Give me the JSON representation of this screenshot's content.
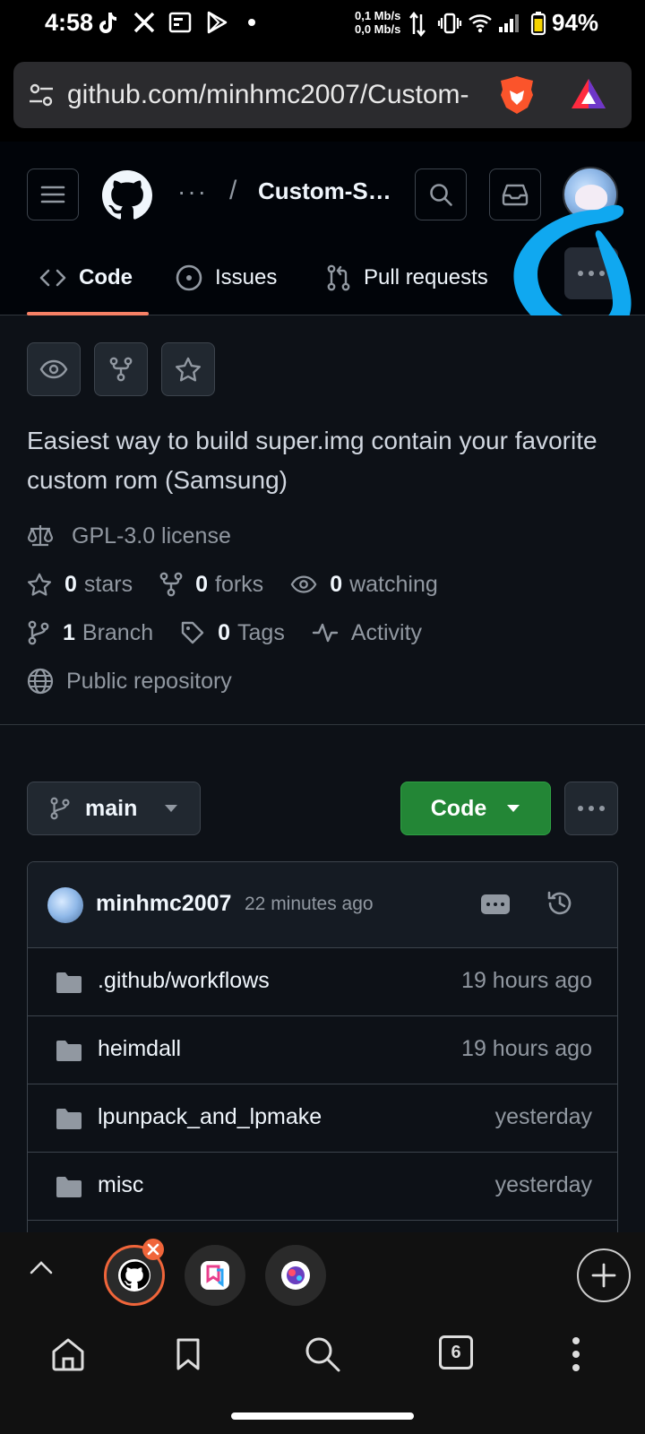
{
  "status_bar": {
    "time": "4:58",
    "net_up": "0,1 Mb/s",
    "net_down": "0,0 Mb/s",
    "battery": "94%"
  },
  "browser": {
    "url": "github.com/minhmc2007/Custom-"
  },
  "header": {
    "breadcrumb_dots": "···",
    "breadcrumb_sep": "/",
    "repo_name": "Custom-S…"
  },
  "tabs": [
    {
      "label": "Code",
      "icon": "code-icon"
    },
    {
      "label": "Issues",
      "icon": "issue-icon"
    },
    {
      "label": "Pull requests",
      "icon": "pull-request-icon"
    }
  ],
  "repo": {
    "description": "Easiest way to build super.img contain your favorite custom rom (Samsung)",
    "license": "GPL-3.0 license",
    "stars_count": "0",
    "stars_label": "stars",
    "forks_count": "0",
    "forks_label": "forks",
    "watching_count": "0",
    "watching_label": "watching",
    "branch_count": "1",
    "branch_label": "Branch",
    "tags_count": "0",
    "tags_label": "Tags",
    "activity_label": "Activity",
    "visibility": "Public repository"
  },
  "toolbar": {
    "branch": "main",
    "code_button": "Code"
  },
  "latest_commit": {
    "user": "minhmc2007",
    "time": "22 minutes ago"
  },
  "files": [
    {
      "name": ".github/workflows",
      "time": "19 hours ago"
    },
    {
      "name": "heimdall",
      "time": "19 hours ago"
    },
    {
      "name": "lpunpack_and_lpmake",
      "time": "yesterday"
    },
    {
      "name": "misc",
      "time": "yesterday"
    }
  ],
  "bottom_nav": {
    "tab_count": "6"
  },
  "colors": {
    "accent_underline": "#f78166",
    "code_button": "#238636",
    "annotation": "#10a8f0"
  }
}
